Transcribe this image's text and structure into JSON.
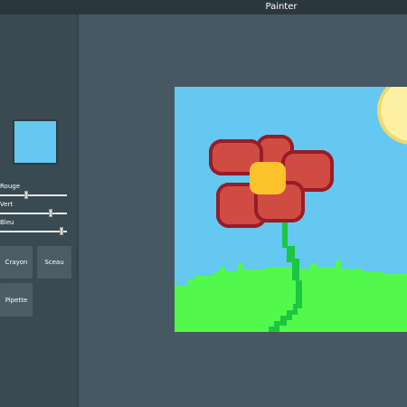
{
  "app": {
    "title": "Painter"
  },
  "color": {
    "preview_hex": "#64c8f0"
  },
  "sliders": [
    {
      "label": "Rouge",
      "value_fraction": 0.39
    },
    {
      "label": "Vert",
      "value_fraction": 0.76
    },
    {
      "label": "Bleu",
      "value_fraction": 0.92
    }
  ],
  "tools": {
    "crayon_label": "Crayon",
    "sceau_label": "Sceau",
    "pipette_label": "Pipette"
  },
  "painting": {
    "sky_color": "#64c8f0",
    "grass_color": "#52f94c",
    "sun_color": "#fff1a3",
    "sun_outline_color": "#f4d66a",
    "petal_color": "#d04b42",
    "petal_outline_color": "#981d28",
    "center_color": "#fcc22b",
    "stem_color": "#1cc640"
  }
}
